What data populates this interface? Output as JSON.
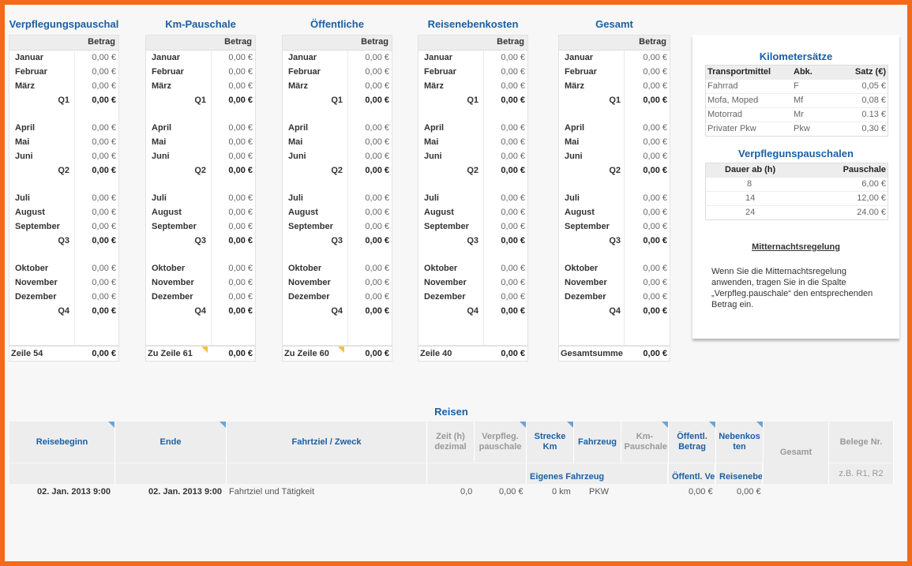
{
  "tables": [
    {
      "title": "Verpflegungspauschal",
      "column_header": "Betrag",
      "quarters": [
        {
          "months": [
            {
              "name": "Januar",
              "value": "0,00 €"
            },
            {
              "name": "Februar",
              "value": "0,00 €"
            },
            {
              "name": "März",
              "value": "0,00 €"
            }
          ],
          "label": "Q1",
          "value": "0,00 €"
        },
        {
          "months": [
            {
              "name": "April",
              "value": "0,00 €"
            },
            {
              "name": "Mai",
              "value": "0,00 €"
            },
            {
              "name": "Juni",
              "value": "0,00 €"
            }
          ],
          "label": "Q2",
          "value": "0,00 €"
        },
        {
          "months": [
            {
              "name": "Juli",
              "value": "0,00 €"
            },
            {
              "name": "August",
              "value": "0,00 €"
            },
            {
              "name": "September",
              "value": "0,00 €"
            }
          ],
          "label": "Q3",
          "value": "0,00 €"
        },
        {
          "months": [
            {
              "name": "Oktober",
              "value": "0,00 €"
            },
            {
              "name": "November",
              "value": "0,00 €"
            },
            {
              "name": "Dezember",
              "value": "0,00 €"
            }
          ],
          "label": "Q4",
          "value": "0,00 €"
        }
      ],
      "footer": {
        "label": "Zeile 54",
        "value": "0,00 €"
      }
    },
    {
      "title": "Km-Pauschale",
      "column_header": "Betrag",
      "quarters": [
        {
          "months": [
            {
              "name": "Januar",
              "value": "0,00 €"
            },
            {
              "name": "Februar",
              "value": "0,00 €"
            },
            {
              "name": "März",
              "value": "0,00 €"
            }
          ],
          "label": "Q1",
          "value": "0,00 €"
        },
        {
          "months": [
            {
              "name": "April",
              "value": "0,00 €"
            },
            {
              "name": "Mai",
              "value": "0,00 €"
            },
            {
              "name": "Juni",
              "value": "0,00 €"
            }
          ],
          "label": "Q2",
          "value": "0,00 €"
        },
        {
          "months": [
            {
              "name": "Juli",
              "value": "0,00 €"
            },
            {
              "name": "August",
              "value": "0,00 €"
            },
            {
              "name": "September",
              "value": "0,00 €"
            }
          ],
          "label": "Q3",
          "value": "0,00 €"
        },
        {
          "months": [
            {
              "name": "Oktober",
              "value": "0,00 €"
            },
            {
              "name": "November",
              "value": "0,00 €"
            },
            {
              "name": "Dezember",
              "value": "0,00 €"
            }
          ],
          "label": "Q4",
          "value": "0,00 €"
        }
      ],
      "footer": {
        "label": "Zu Zeile 61",
        "value": "0,00 €"
      }
    },
    {
      "title": "Öffentliche",
      "column_header": "Betrag",
      "quarters": [
        {
          "months": [
            {
              "name": "Januar",
              "value": "0,00 €"
            },
            {
              "name": "Februar",
              "value": "0,00 €"
            },
            {
              "name": "März",
              "value": "0,00 €"
            }
          ],
          "label": "Q1",
          "value": "0,00 €"
        },
        {
          "months": [
            {
              "name": "April",
              "value": "0,00 €"
            },
            {
              "name": "Mai",
              "value": "0,00 €"
            },
            {
              "name": "Juni",
              "value": "0,00 €"
            }
          ],
          "label": "Q2",
          "value": "0,00 €"
        },
        {
          "months": [
            {
              "name": "Juli",
              "value": "0,00 €"
            },
            {
              "name": "August",
              "value": "0,00 €"
            },
            {
              "name": "September",
              "value": "0,00 €"
            }
          ],
          "label": "Q3",
          "value": "0,00 €"
        },
        {
          "months": [
            {
              "name": "Oktober",
              "value": "0,00 €"
            },
            {
              "name": "November",
              "value": "0,00 €"
            },
            {
              "name": "Dezember",
              "value": "0,00 €"
            }
          ],
          "label": "Q4",
          "value": "0,00 €"
        }
      ],
      "footer": {
        "label": "Zu Zeile 60",
        "value": "0,00 €"
      }
    },
    {
      "title": "Reisenebenkosten",
      "column_header": "Betrag",
      "quarters": [
        {
          "months": [
            {
              "name": "Januar",
              "value": "0,00 €"
            },
            {
              "name": "Februar",
              "value": "0,00 €"
            },
            {
              "name": "März",
              "value": "0,00 €"
            }
          ],
          "label": "Q1",
          "value": "0,00 €"
        },
        {
          "months": [
            {
              "name": "April",
              "value": "0,00 €"
            },
            {
              "name": "Mai",
              "value": "0,00 €"
            },
            {
              "name": "Juni",
              "value": "0,00 €"
            }
          ],
          "label": "Q2",
          "value": "0,00 €"
        },
        {
          "months": [
            {
              "name": "Juli",
              "value": "0,00 €"
            },
            {
              "name": "August",
              "value": "0,00 €"
            },
            {
              "name": "September",
              "value": "0,00 €"
            }
          ],
          "label": "Q3",
          "value": "0,00 €"
        },
        {
          "months": [
            {
              "name": "Oktober",
              "value": "0,00 €"
            },
            {
              "name": "November",
              "value": "0,00 €"
            },
            {
              "name": "Dezember",
              "value": "0,00 €"
            }
          ],
          "label": "Q4",
          "value": "0,00 €"
        }
      ],
      "footer": {
        "label": "Zeile 40",
        "value": "0,00 €"
      }
    },
    {
      "title": "Gesamt",
      "column_header": "Betrag",
      "quarters": [
        {
          "months": [
            {
              "name": "Januar",
              "value": "0,00 €"
            },
            {
              "name": "Februar",
              "value": "0,00 €"
            },
            {
              "name": "März",
              "value": "0,00 €"
            }
          ],
          "label": "Q1",
          "value": "0,00 €"
        },
        {
          "months": [
            {
              "name": "April",
              "value": "0,00 €"
            },
            {
              "name": "Mai",
              "value": "0,00 €"
            },
            {
              "name": "Juni",
              "value": "0,00 €"
            }
          ],
          "label": "Q2",
          "value": "0,00 €"
        },
        {
          "months": [
            {
              "name": "Juli",
              "value": "0,00 €"
            },
            {
              "name": "August",
              "value": "0,00 €"
            },
            {
              "name": "September",
              "value": "0,00 €"
            }
          ],
          "label": "Q3",
          "value": "0,00 €"
        },
        {
          "months": [
            {
              "name": "Oktober",
              "value": "0,00 €"
            },
            {
              "name": "November",
              "value": "0,00 €"
            },
            {
              "name": "Dezember",
              "value": "0,00 €"
            }
          ],
          "label": "Q4",
          "value": "0,00 €"
        }
      ],
      "footer": {
        "label": "Gesamtsumme",
        "value": "0,00 €"
      }
    }
  ],
  "panel": {
    "kilometer": {
      "title": "Kilometersätze",
      "headers": [
        "Transportmittel",
        "Abk.",
        "Satz (€)"
      ],
      "rows": [
        [
          "Fahrrad",
          "F",
          "0,05 €"
        ],
        [
          "Mofa, Moped",
          "Mf",
          "0,08 €"
        ],
        [
          "Motorrad",
          "Mr",
          "0.13 €"
        ],
        [
          "Privater Pkw",
          "Pkw",
          "0,30 €"
        ]
      ]
    },
    "verpflegung": {
      "title": "Verpflegunspauschalen",
      "headers": [
        "Dauer ab  (h)",
        "Pauschale"
      ],
      "rows": [
        [
          "8",
          "6,00 €"
        ],
        [
          "14",
          "12,00 €"
        ],
        [
          "24",
          "24.00 €"
        ]
      ]
    },
    "note_heading": "Mitternachtsregelung",
    "note_text": "Wenn Sie die Mitternachtsregelung anwenden, tragen Sie in die Spalte „Verpfleg.pauschale“ den entsprechenden Betrag ein."
  },
  "reisen": {
    "title": "Reisen",
    "headers": {
      "reisebeginn": "Reisebeginn",
      "ende": "Ende",
      "fahrtziel": "Fahrtziel / Zweck",
      "zeit": "Zeit (h) dezimal",
      "verpfleg": "Verpfleg. pauschale",
      "strecke": "Strecke Km",
      "fahrzeug": "Fahrzeug",
      "km_pauschale": "Km-Pauschale",
      "oeffentl": "Öffentl. Betrag",
      "nebenkosten": "Nebenkos ten",
      "gesamt": "Gesamt",
      "belege": "Belege Nr."
    },
    "subheaders": {
      "eigenes_fahrzeug": "Eigenes Fahrzeug",
      "oeffentl_ver": "Öffentl. Ver",
      "reisenebe": "Reisenebe",
      "belege_hint": "z.B. R1, R2"
    },
    "row": {
      "beginn": "02. Jan. 2013  9:00",
      "ende": "02. Jan. 2013  9:00",
      "fahrtziel": "Fahrtziel und Tätigkeit",
      "zeit": "0,0",
      "verpfleg": "0,00 €",
      "strecke": "0 km",
      "fahrzeug": "PKW",
      "oeffentl": "0,00 €",
      "nebenkosten": "0,00 €"
    }
  }
}
